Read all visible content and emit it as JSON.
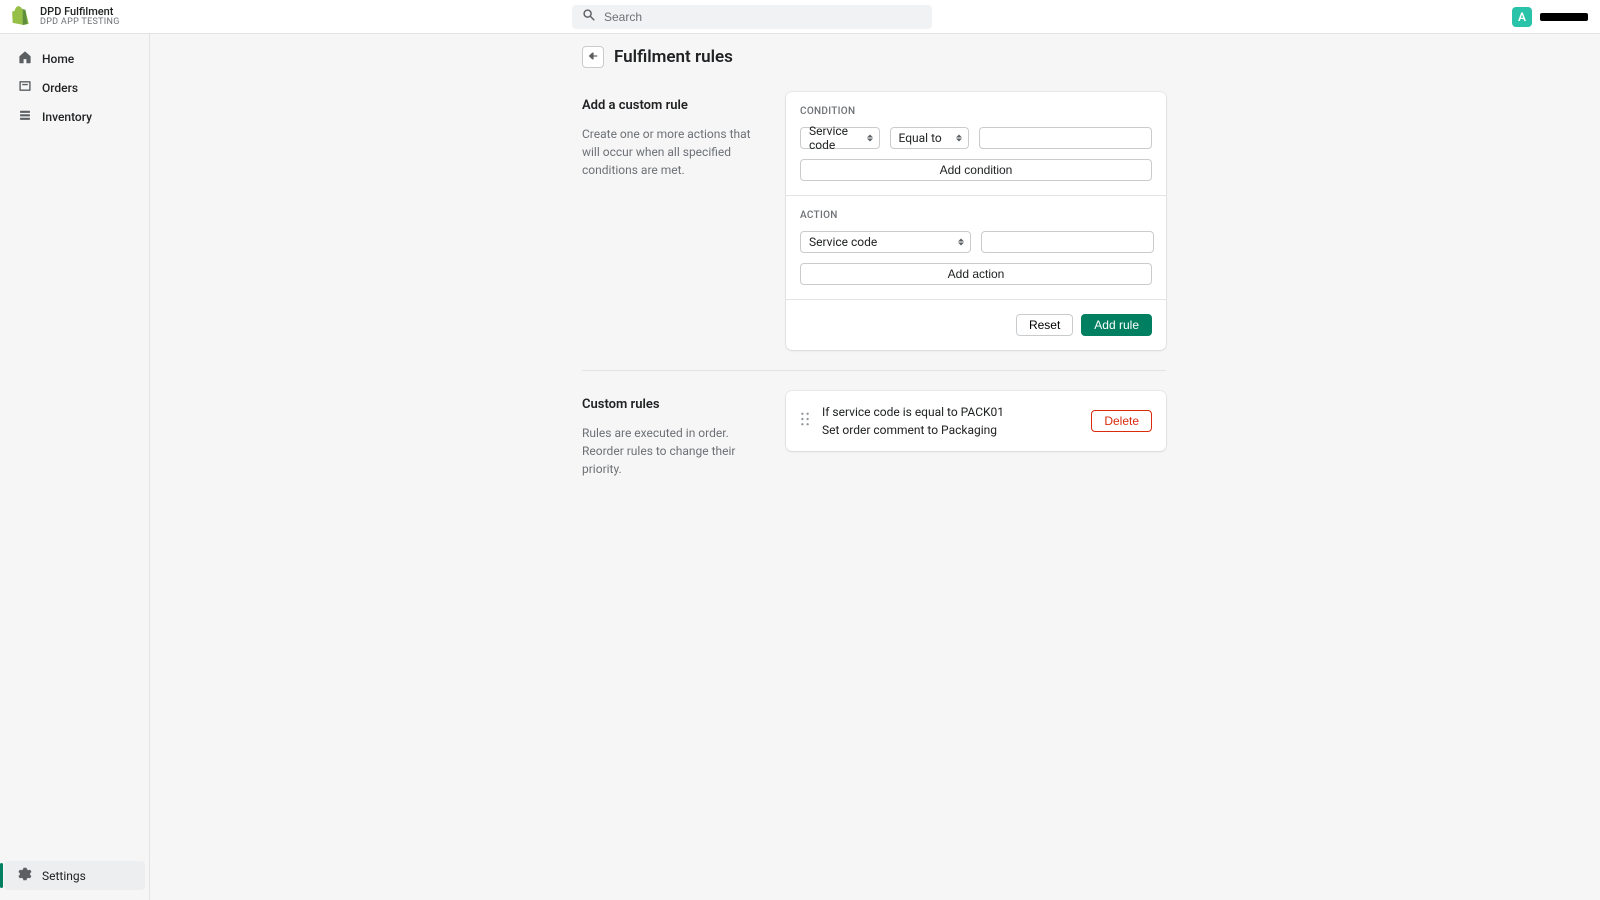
{
  "header": {
    "brand_title": "DPD Fulfilment",
    "brand_sub": "DPD APP TESTING",
    "search_placeholder": "Search",
    "avatar_initial": "A"
  },
  "sidebar": {
    "items": [
      {
        "label": "Home"
      },
      {
        "label": "Orders"
      },
      {
        "label": "Inventory"
      }
    ],
    "settings_label": "Settings"
  },
  "page": {
    "title": "Fulfilment rules"
  },
  "add_rule": {
    "heading": "Add a custom rule",
    "description": "Create one or more actions that will occur when all specified conditions are met.",
    "condition_label": "Condition",
    "condition_field_select": "Service code",
    "condition_op_select": "Equal to",
    "add_condition_btn": "Add condition",
    "action_label": "Action",
    "action_field_select": "Service code",
    "add_action_btn": "Add action",
    "reset_btn": "Reset",
    "add_rule_btn": "Add rule"
  },
  "custom_rules": {
    "heading": "Custom rules",
    "description": "Rules are executed in order. Reorder rules to change their priority.",
    "rules": [
      {
        "line1": "If service code is equal to PACK01",
        "line2": "Set order comment to Packaging"
      }
    ],
    "delete_btn": "Delete"
  }
}
